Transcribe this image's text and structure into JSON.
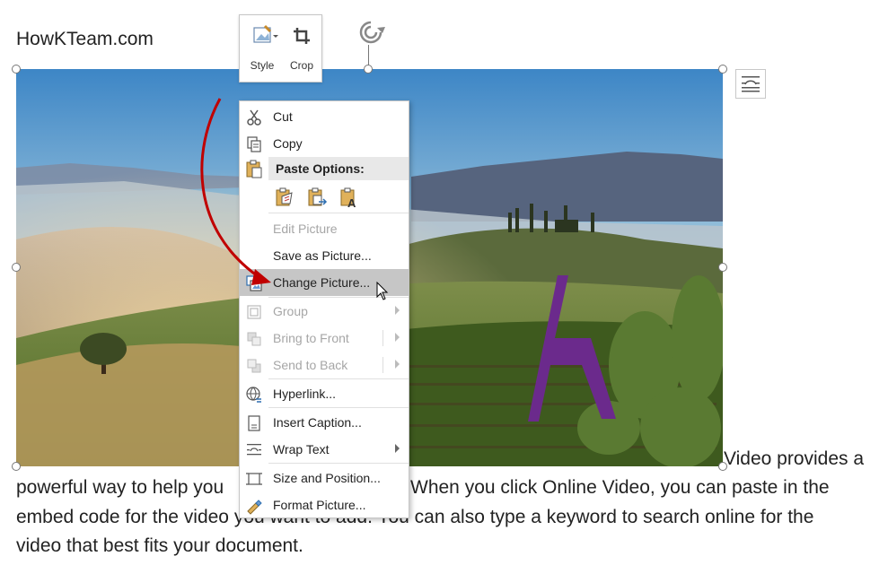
{
  "document": {
    "heading": "HowKTeam.com",
    "paragraph_lines": [
      "Video provides a",
      "powerful way to help you",
      "When you click Online Video, you can paste in the",
      "embed code for the video you want to add. You can also type a keyword to search online for the",
      "video that best fits your document."
    ]
  },
  "mini_toolbar": {
    "style_label": "Style",
    "crop_label": "Crop"
  },
  "context_menu": {
    "cut": "Cut",
    "copy": "Copy",
    "paste_options": "Paste Options:",
    "edit_picture": "Edit Picture",
    "save_as_picture": "Save as Picture...",
    "change_picture": "Change Picture...",
    "group": "Group",
    "bring_to_front": "Bring to Front",
    "send_to_back": "Send to Back",
    "hyperlink": "Hyperlink...",
    "insert_caption": "Insert Caption...",
    "wrap_text": "Wrap Text",
    "size_and_position": "Size and Position...",
    "format_picture": "Format Picture..."
  },
  "colors": {
    "accent_red": "#c00000",
    "logo_purple": "#6b2a8c",
    "menu_hover": "#c6c6c6",
    "disabled_text": "#a6a6a6"
  },
  "icons": [
    "scissors-icon",
    "copy-icon",
    "paste-icon",
    "keep-source-formatting-icon",
    "merge-formatting-icon",
    "keep-text-only-icon",
    "change-picture-icon",
    "group-icon",
    "bring-to-front-icon",
    "send-to-back-icon",
    "hyperlink-icon",
    "insert-caption-icon",
    "wrap-text-icon",
    "size-position-icon",
    "format-picture-icon",
    "rotate-icon",
    "layout-options-icon",
    "mouse-pointer-icon",
    "style-icon",
    "crop-icon"
  ]
}
